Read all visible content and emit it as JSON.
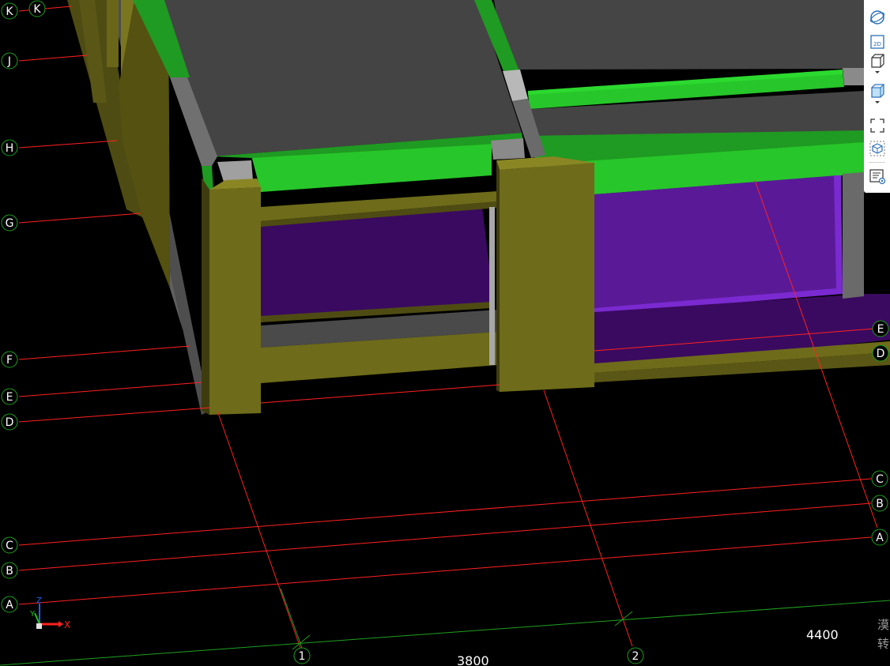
{
  "grid": {
    "row_bubbles_left": [
      "K",
      "J",
      "H",
      "G",
      "F",
      "E",
      "D",
      "C",
      "B",
      "A"
    ],
    "row_bubbles_right": [
      "C",
      "B",
      "A",
      "E",
      "D"
    ],
    "row_bubble_top_extra": "K",
    "column_bubbles": [
      "1",
      "2"
    ],
    "dimensions": [
      "3800",
      "4400"
    ]
  },
  "axes_gizmo": {
    "x": "X",
    "y": "Y",
    "z": "Z"
  },
  "status_partial": [
    "漠",
    "转"
  ],
  "toolbar": {
    "items": [
      {
        "name": "orbit-icon"
      },
      {
        "name": "view-2d-icon",
        "label": "2D"
      },
      {
        "name": "view-3d-box-icon",
        "has_dropdown": true
      },
      {
        "name": "shaded-box-icon",
        "has_dropdown": true
      },
      {
        "name": "fit-view-icon"
      },
      {
        "name": "section-box-icon"
      },
      {
        "name": "properties-icon"
      }
    ]
  },
  "colors": {
    "background": "#000000",
    "grid_line": "#ff2020",
    "dimension_line": "#1fa01f",
    "slab": "#444444",
    "beam_green": "#27c62a",
    "column_olive": "#6e6b1a",
    "wall_purple": "#4a1278",
    "wall_gray": "#6a6a6a"
  }
}
